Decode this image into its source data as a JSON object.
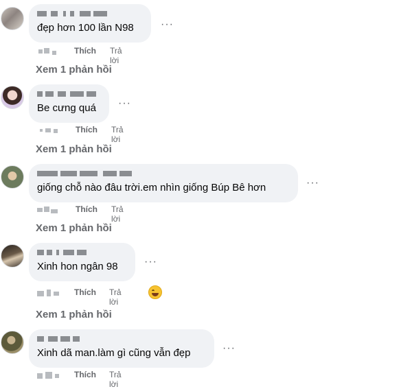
{
  "comments": [
    {
      "text": "đẹp hơn 100 lần N98",
      "like_label": "Thích",
      "reply_label": "Trả lời",
      "view_replies": "Xem 1 phản hồi",
      "more_icon": "more-options-icon"
    },
    {
      "text": "Be cưng quá",
      "like_label": "Thích",
      "reply_label": "Trả lời",
      "view_replies": "Xem 1 phản hồi",
      "more_icon": "more-options-icon"
    },
    {
      "text": "giống chỗ nào đâu trời.em nhìn giống Búp Bê hơn",
      "like_label": "Thích",
      "reply_label": "Trả lời",
      "view_replies": "Xem 1 phản hồi",
      "more_icon": "more-options-icon"
    },
    {
      "text": "Xinh hon ngân 98",
      "like_label": "Thích",
      "reply_label": "Trả lời",
      "view_replies": "Xem 1 phản hồi",
      "more_icon": "more-options-icon",
      "reaction": "haha-emoji-icon"
    },
    {
      "text": "Xinh dã man.làm gì cũng vẫn đẹp",
      "like_label": "Thích",
      "reply_label": "Trả lời",
      "more_icon": "more-options-icon"
    }
  ],
  "colors": {
    "bubble": "#f0f2f5",
    "secondary_text": "#65676b",
    "primary_text": "#050505"
  }
}
